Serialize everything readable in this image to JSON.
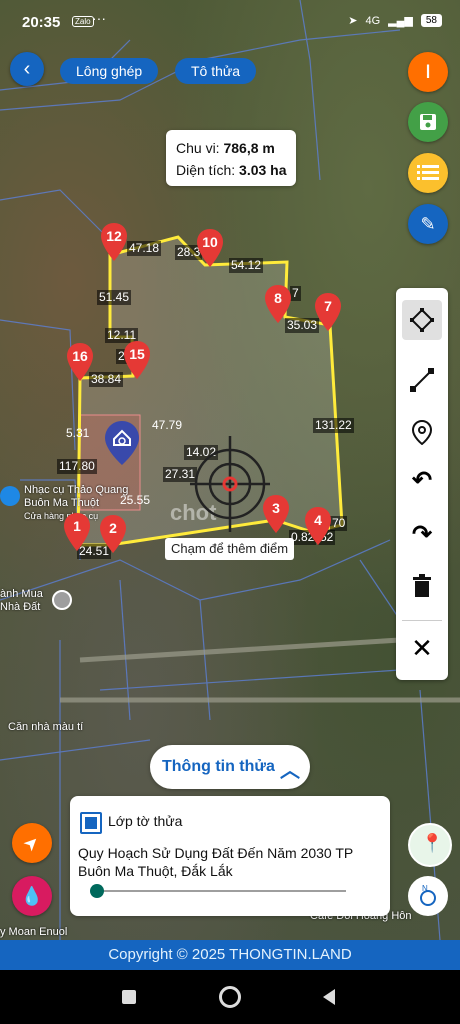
{
  "status": {
    "time": "20:35",
    "zalo": "Zalo",
    "dots": "···",
    "network": "4G",
    "battery": "58"
  },
  "top_chips": [
    "Lông ghép",
    "Tô thửa"
  ],
  "info_box": {
    "perimeter_label": "Chu vi:",
    "perimeter_value": "786,8 m",
    "area_label": "Diện tích:",
    "area_value": "3.03 ha"
  },
  "edge_labels": [
    "47.18",
    "28.3",
    "54.12",
    "7",
    "35.03",
    "51.45",
    "12.11",
    "2",
    "38.84",
    "5.31",
    "47.79",
    "131.22",
    "14.02",
    "27.31",
    "117.80",
    "25.55",
    "24.51",
    "0.82",
    "52",
    "70"
  ],
  "markers": [
    "12",
    "10",
    "8",
    "7",
    "16",
    "15",
    "1",
    "2",
    "3",
    "4"
  ],
  "map_labels": {
    "place1": "Nhạc cụ Thảo Quang Buôn Ma Thuột",
    "place1_sub": "Cửa hàng nhạc cụ",
    "place2": "ành Mua Nhà Đất",
    "place3": "Căn nhà màu tí",
    "place4": "Cafe Đồi Hoàng Hôn",
    "place5": "y Moan Enuol",
    "watermark": "chot"
  },
  "hint": "Chạm để thêm điểm",
  "info_button": {
    "label": "Thông tin thửa",
    "icon": "chevron-up-icon"
  },
  "layer": {
    "checkbox_label": "Lớp tờ thửa",
    "plan_title": "Quy Hoạch Sử Dụng Đất Đến Năm 2030 TP Buôn Ma Thuột, Đắk Lắk",
    "opacity": 0
  },
  "copyright": "Copyright © 2025 THONGTIN.LAND",
  "colors": {
    "accent": "#1565c0",
    "boundary": "#ffeb3b",
    "marker": "#e53935",
    "orange": "#ff6f00",
    "green": "#43a047",
    "yellow": "#fbc02d"
  }
}
